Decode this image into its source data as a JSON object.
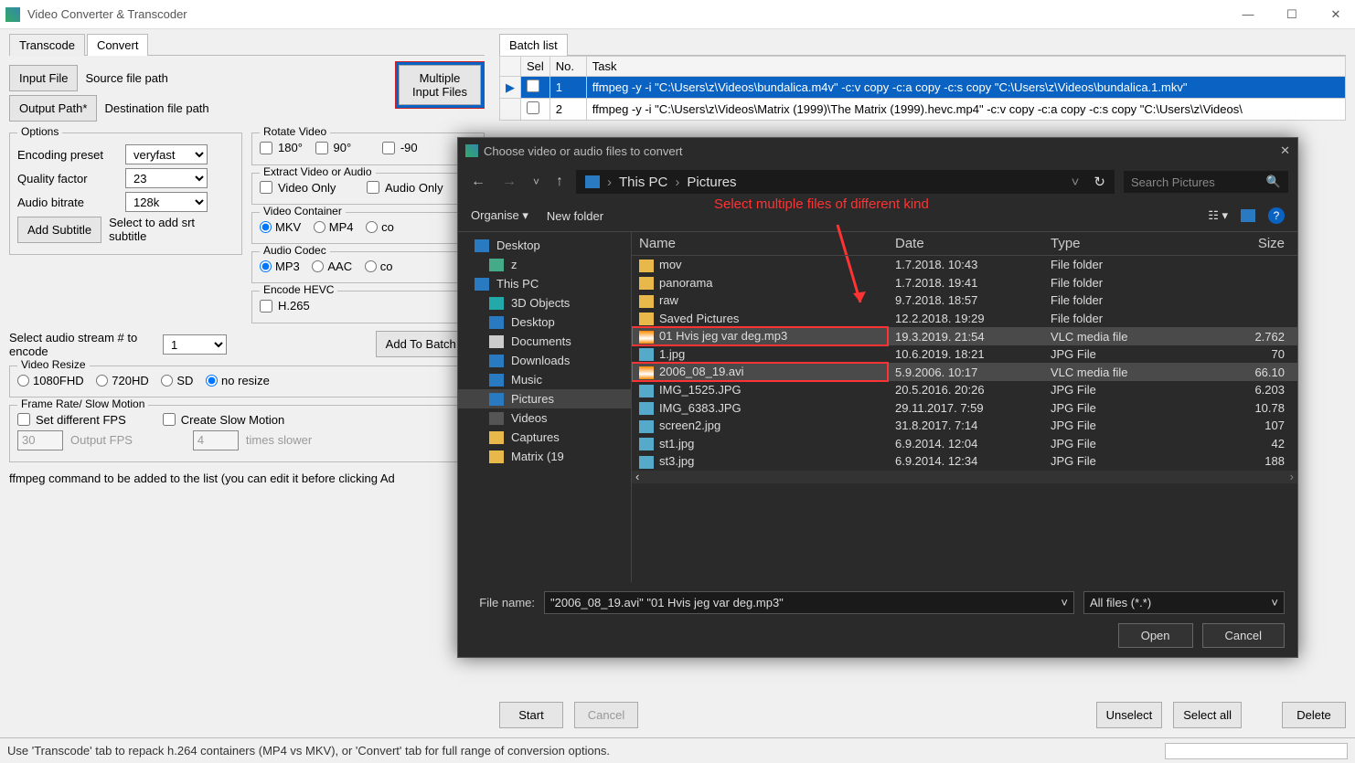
{
  "window": {
    "title": "Video Converter & Transcoder"
  },
  "tabs": {
    "transcode": "Transcode",
    "convert": "Convert"
  },
  "buttons": {
    "input_file": "Input File",
    "output_path": "Output Path*",
    "multiple_input": "Multiple Input Files",
    "add_subtitle": "Add Subtitle",
    "add_batch": "Add To Batch Lis"
  },
  "labels": {
    "source": "Source file path",
    "dest": "Destination file path",
    "rotate": "Rotate Video",
    "rot180": "180°",
    "rot90": "90°",
    "rotn90": "-90",
    "extract": "Extract Video or Audio",
    "video_only": "Video Only",
    "audio_only": "Audio Only",
    "options": "Options",
    "enc_preset": "Encoding preset",
    "quality": "Quality factor",
    "audio_bitrate": "Audio bitrate",
    "subtitle_hint": "Select to add srt subtitle",
    "video_container": "Video Container",
    "audio_codec": "Audio Codec",
    "encode_hevc": "Encode HEVC",
    "h265": "H.265",
    "audio_stream": "Select audio stream # to encode",
    "video_resize": "Video Resize",
    "framerate": "Frame Rate/ Slow Motion",
    "set_fps": "Set different FPS",
    "create_slow": "Create Slow Motion",
    "output_fps_ph": "Output FPS",
    "times_slower": "times slower",
    "cmd_hint": "ffmpeg command to be added to the list (you can edit it before clicking Ad"
  },
  "values": {
    "preset": "veryfast",
    "quality": "23",
    "bitrate": "128k",
    "stream": "1",
    "fps": "30",
    "slow": "4"
  },
  "container_opts": {
    "mkv": "MKV",
    "mp4": "MP4",
    "co": "co"
  },
  "codec_opts": {
    "mp3": "MP3",
    "aac": "AAC",
    "co": "co"
  },
  "resize_opts": {
    "fhd": "1080FHD",
    "hd": "720HD",
    "sd": "SD",
    "none": "no resize"
  },
  "batch": {
    "tab": "Batch list",
    "cols": {
      "sel": "Sel",
      "no": "No.",
      "task": "Task"
    },
    "rows": [
      {
        "no": "1",
        "task": "ffmpeg -y -i \"C:\\Users\\z\\Videos\\bundalica.m4v\" -c:v copy -c:a copy -c:s copy \"C:\\Users\\z\\Videos\\bundalica.1.mkv\""
      },
      {
        "no": "2",
        "task": "ffmpeg -y -i \"C:\\Users\\z\\Videos\\Matrix (1999)\\The Matrix (1999).hevc.mp4\" -c:v copy -c:a copy -c:s copy \"C:\\Users\\z\\Videos\\"
      }
    ],
    "start": "Start",
    "cancel": "Cancel",
    "unselect": "Unselect",
    "select_all": "Select all",
    "delete": "Delete"
  },
  "status": "Use 'Transcode' tab to repack h.264 containers (MP4 vs MKV), or 'Convert' tab for full range of conversion options.",
  "dialog": {
    "title": "Choose video or audio files to convert",
    "crumbs": {
      "pc": "This PC",
      "loc": "Pictures"
    },
    "search_ph": "Search Pictures",
    "organise": "Organise",
    "new_folder": "New folder",
    "annotation": "Select multiple files of different kind",
    "tree": [
      {
        "name": "Desktop",
        "cls": "desktop",
        "lvl": 1
      },
      {
        "name": "z",
        "cls": "user",
        "lvl": 2
      },
      {
        "name": "This PC",
        "cls": "pc",
        "lvl": 1
      },
      {
        "name": "3D Objects",
        "cls": "obj3d",
        "lvl": 2
      },
      {
        "name": "Desktop",
        "cls": "desktop",
        "lvl": 2
      },
      {
        "name": "Documents",
        "cls": "docs",
        "lvl": 2
      },
      {
        "name": "Downloads",
        "cls": "dl",
        "lvl": 2
      },
      {
        "name": "Music",
        "cls": "music",
        "lvl": 2
      },
      {
        "name": "Pictures",
        "cls": "pics",
        "lvl": 2,
        "sel": true
      },
      {
        "name": "Videos",
        "cls": "video",
        "lvl": 2
      },
      {
        "name": "Captures",
        "cls": "folder",
        "lvl": 2
      },
      {
        "name": "Matrix (19",
        "cls": "folder",
        "lvl": 2
      }
    ],
    "cols": {
      "name": "Name",
      "date": "Date",
      "type": "Type",
      "size": "Size"
    },
    "files": [
      {
        "name": "mov",
        "date": "1.7.2018. 10:43",
        "type": "File folder",
        "size": "",
        "icon": "folder"
      },
      {
        "name": "panorama",
        "date": "1.7.2018. 19:41",
        "type": "File folder",
        "size": "",
        "icon": "folder"
      },
      {
        "name": "raw",
        "date": "9.7.2018. 18:57",
        "type": "File folder",
        "size": "",
        "icon": "folder"
      },
      {
        "name": "Saved Pictures",
        "date": "12.2.2018. 19:29",
        "type": "File folder",
        "size": "",
        "icon": "folder"
      },
      {
        "name": "01 Hvis jeg var deg.mp3",
        "date": "19.3.2019. 21:54",
        "type": "VLC media file",
        "size": "2.762",
        "icon": "vlc",
        "sel": true,
        "red": true
      },
      {
        "name": "1.jpg",
        "date": "10.6.2019. 18:21",
        "type": "JPG File",
        "size": "70",
        "icon": "jpg"
      },
      {
        "name": "2006_08_19.avi",
        "date": "5.9.2006. 10:17",
        "type": "VLC media file",
        "size": "66.10",
        "icon": "vlc",
        "sel": true,
        "red": true
      },
      {
        "name": "IMG_1525.JPG",
        "date": "20.5.2016. 20:26",
        "type": "JPG File",
        "size": "6.203",
        "icon": "jpg"
      },
      {
        "name": "IMG_6383.JPG",
        "date": "29.11.2017. 7:59",
        "type": "JPG File",
        "size": "10.78",
        "icon": "jpg"
      },
      {
        "name": "screen2.jpg",
        "date": "31.8.2017. 7:14",
        "type": "JPG File",
        "size": "107",
        "icon": "jpg"
      },
      {
        "name": "st1.jpg",
        "date": "6.9.2014. 12:04",
        "type": "JPG File",
        "size": "42",
        "icon": "jpg"
      },
      {
        "name": "st3.jpg",
        "date": "6.9.2014. 12:34",
        "type": "JPG File",
        "size": "188",
        "icon": "jpg"
      }
    ],
    "filename_label": "File name:",
    "filename_value": "\"2006_08_19.avi\" \"01 Hvis jeg var deg.mp3\"",
    "filter": "All files (*.*)",
    "open": "Open",
    "cancel": "Cancel"
  }
}
